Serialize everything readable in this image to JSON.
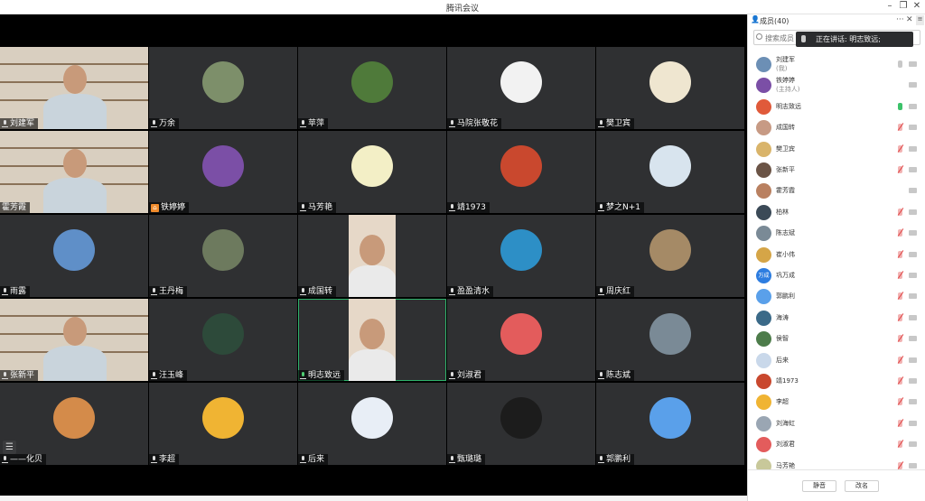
{
  "window": {
    "title": "腾讯会议"
  },
  "tiles": [
    {
      "name": "刘建军",
      "kind": "person",
      "mic": "normal"
    },
    {
      "name": "万余",
      "kind": "avatar",
      "color": "#7d8f6a",
      "mic": "normal"
    },
    {
      "name": "苹萍",
      "kind": "avatar",
      "color": "#4f7a3a",
      "mic": "normal"
    },
    {
      "name": "马院张敬花",
      "kind": "avatar",
      "color": "#f2f2f2",
      "mic": "normal"
    },
    {
      "name": "樊卫宾",
      "kind": "avatar",
      "color": "#efe6d0",
      "mic": "normal"
    },
    {
      "name": "霍芳霞",
      "kind": "person",
      "mic": "none"
    },
    {
      "name": "铁婷婷",
      "kind": "avatar",
      "color": "#7b4fa6",
      "mic": "host"
    },
    {
      "name": "马芳艳",
      "kind": "avatar",
      "color": "#f3efc6",
      "mic": "normal"
    },
    {
      "name": "靖1973",
      "kind": "avatar",
      "color": "#c9482e",
      "mic": "normal"
    },
    {
      "name": "梦之N+1",
      "kind": "avatar",
      "color": "#d8e4ee",
      "mic": "normal"
    },
    {
      "name": "雨露",
      "kind": "avatar",
      "color": "#5f8fc8",
      "mic": "normal"
    },
    {
      "name": "王丹梅",
      "kind": "avatar",
      "color": "#6d7a5e",
      "mic": "normal"
    },
    {
      "name": "成国转",
      "kind": "person",
      "mic": "normal"
    },
    {
      "name": "盈盈清水",
      "kind": "avatar",
      "color": "#2d8fc6",
      "mic": "normal"
    },
    {
      "name": "周庆红",
      "kind": "avatar",
      "color": "#a58a66",
      "mic": "normal"
    },
    {
      "name": "张新平",
      "kind": "person",
      "mic": "normal"
    },
    {
      "name": "汪玉峰",
      "kind": "avatar",
      "color": "#2d4a3a",
      "mic": "normal"
    },
    {
      "name": "明志致远",
      "kind": "person",
      "mic": "on",
      "active": true
    },
    {
      "name": "刘淑君",
      "kind": "avatar",
      "color": "#e35c5c",
      "mic": "normal"
    },
    {
      "name": "陈志斌",
      "kind": "avatar",
      "color": "#7a8a96",
      "mic": "normal"
    },
    {
      "name": "——化贝",
      "kind": "avatar",
      "color": "#d48b4a",
      "mic": "normal"
    },
    {
      "name": "李超",
      "kind": "avatar",
      "color": "#f0b433",
      "mic": "normal"
    },
    {
      "name": "后来",
      "kind": "avatar",
      "color": "#e8eef6",
      "mic": "normal"
    },
    {
      "name": "甄璐璐",
      "kind": "avatar",
      "color": "#1c1c1c",
      "mic": "normal"
    },
    {
      "name": "郭鹏利",
      "kind": "avatar",
      "color": "#5aa0ea",
      "mic": "normal"
    }
  ],
  "panel": {
    "title": "成员(40)",
    "search_placeholder": "搜索成员",
    "speaking_text": "正在讲话: 明志致远;",
    "members": [
      {
        "name": "刘建军",
        "role": "(我)",
        "color": "#6c8fb5",
        "mic": "normal"
      },
      {
        "name": "铁婷婷",
        "role": "(主持人)",
        "color": "#7b4fa6",
        "mic": "none"
      },
      {
        "name": "明志致远",
        "role": "",
        "color": "#e05a3a",
        "mic": "on"
      },
      {
        "name": "成国转",
        "role": "",
        "color": "#c79a84",
        "mic": "muted"
      },
      {
        "name": "樊卫宾",
        "role": "",
        "color": "#d9b46a",
        "mic": "muted"
      },
      {
        "name": "张新平",
        "role": "",
        "color": "#6b5446",
        "mic": "muted"
      },
      {
        "name": "霍芳霞",
        "role": "",
        "color": "#b98060",
        "mic": "none"
      },
      {
        "name": "柏林",
        "role": "",
        "color": "#3b4a57",
        "mic": "muted"
      },
      {
        "name": "陈志斌",
        "role": "",
        "color": "#7a8a96",
        "mic": "muted"
      },
      {
        "name": "崔小伟",
        "role": "",
        "color": "#d5a547",
        "mic": "muted"
      },
      {
        "name": "巩万成",
        "role": "",
        "color": "#2d7de0",
        "mic": "muted",
        "initials": "万成"
      },
      {
        "name": "郭鹏利",
        "role": "",
        "color": "#5aa0ea",
        "mic": "muted"
      },
      {
        "name": "海涛",
        "role": "",
        "color": "#3b6a88",
        "mic": "muted"
      },
      {
        "name": "侯智",
        "role": "",
        "color": "#4d7c4a",
        "mic": "muted"
      },
      {
        "name": "后来",
        "role": "",
        "color": "#c9d8ea",
        "mic": "muted"
      },
      {
        "name": "靖1973",
        "role": "",
        "color": "#c9482e",
        "mic": "muted"
      },
      {
        "name": "李超",
        "role": "",
        "color": "#f0b433",
        "mic": "muted"
      },
      {
        "name": "刘海虹",
        "role": "",
        "color": "#9aa6b3",
        "mic": "muted"
      },
      {
        "name": "刘淑君",
        "role": "",
        "color": "#e35c5c",
        "mic": "muted"
      },
      {
        "name": "马芳艳",
        "role": "",
        "color": "#c8c89a",
        "mic": "muted"
      }
    ],
    "mute_all_label": "静音",
    "rename_label": "改名"
  }
}
